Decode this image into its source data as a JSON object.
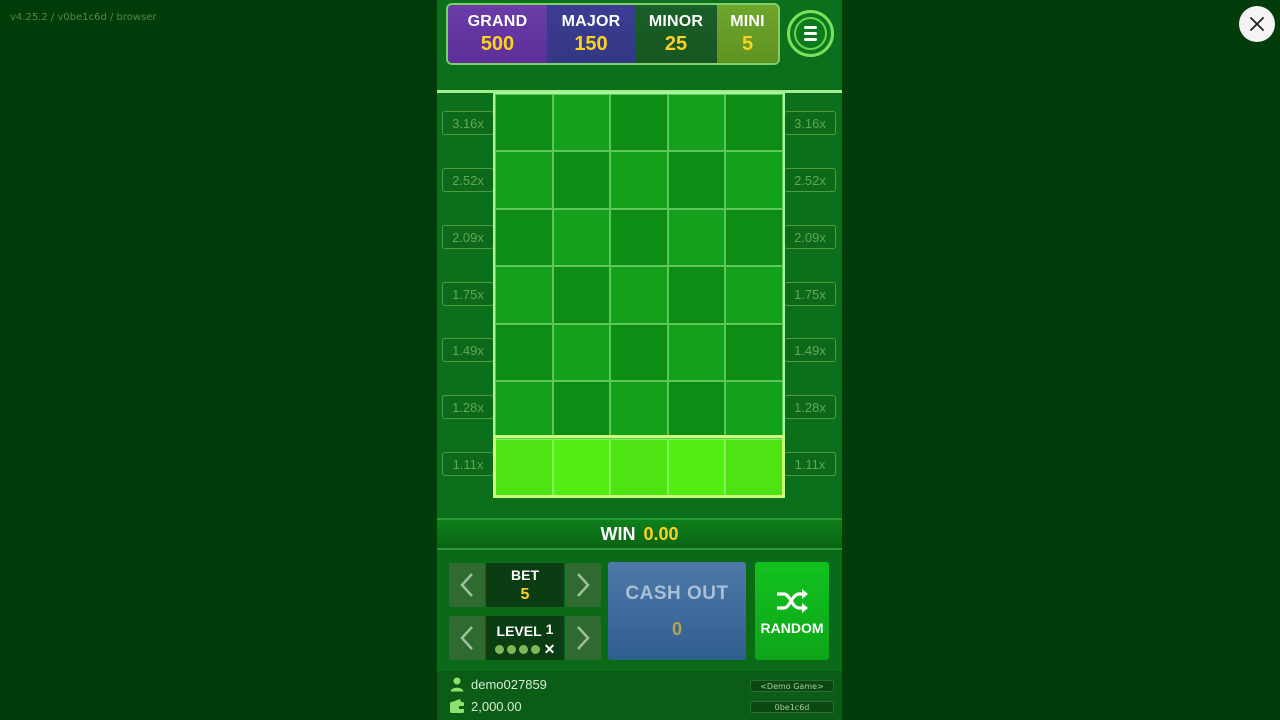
{
  "version_text": "v4.25.2 / v0be1c6d / browser",
  "jackpots": [
    {
      "name": "GRAND",
      "value": "500"
    },
    {
      "name": "MAJOR",
      "value": "150"
    },
    {
      "name": "MINOR",
      "value": "25"
    },
    {
      "name": "MINI",
      "value": "5"
    }
  ],
  "multipliers": [
    "3.16x",
    "2.52x",
    "2.09x",
    "1.75x",
    "1.49x",
    "1.28x",
    "1.11x"
  ],
  "grid": {
    "rows": 7,
    "cols": 5,
    "active_row_from_bottom": 1
  },
  "win": {
    "label": "WIN",
    "value": "0.00"
  },
  "bet": {
    "label": "BET",
    "value": "5"
  },
  "level": {
    "label": "LEVEL",
    "value": "1",
    "indicator_dots": 4
  },
  "cashout": {
    "label": "CASH OUT",
    "value": "0"
  },
  "random": {
    "label": "RANDOM"
  },
  "footer": {
    "username": "demo027859",
    "balance": "2,000.00",
    "demo_tag": "<Demo Game>",
    "build_tag": "0be1c6d"
  },
  "colors": {
    "background": "#003d0a",
    "game_panel": "#0c6f1c",
    "accent_yellow": "#ffd21f",
    "active_row": "#4ee312",
    "cashout_blue": "#3d6c9c",
    "random_green": "#12c21f"
  },
  "icons": [
    "close-icon",
    "menu-icon",
    "chevron-left-icon",
    "chevron-right-icon",
    "shuffle-icon",
    "user-icon",
    "wallet-icon"
  ]
}
